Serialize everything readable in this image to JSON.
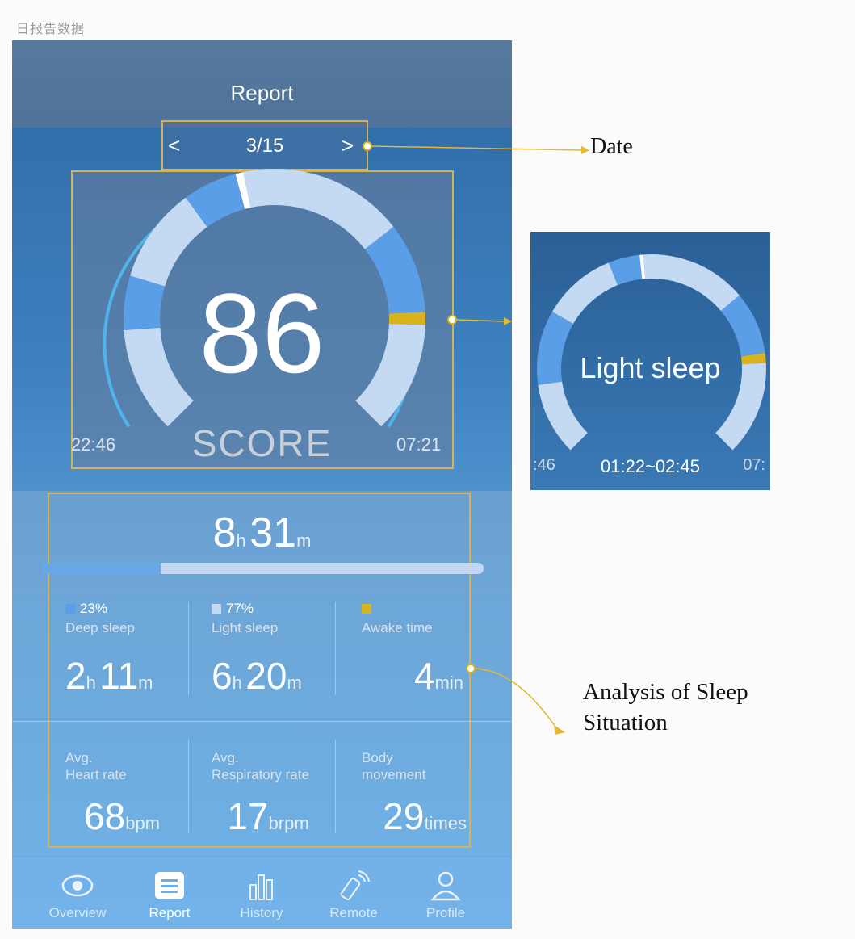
{
  "page_caption": "日报告数据",
  "header": {
    "title": "Report"
  },
  "date_nav": {
    "prev": "<",
    "date": "3/15",
    "next": ">"
  },
  "score": {
    "value": "86",
    "label": "SCORE",
    "start_time": "22:46",
    "end_time": "07:21"
  },
  "summary": {
    "total_hours": "8",
    "total_hours_unit": "h",
    "total_minutes": "31",
    "total_minutes_unit": "m",
    "deep_fraction": 0.27
  },
  "stages": [
    {
      "pct": "23%",
      "label": "Deep sleep",
      "v1": "2",
      "u1": "h",
      "v2": "11",
      "u2": "m",
      "color": "#5b9ee8"
    },
    {
      "pct": "77%",
      "label": "Light sleep",
      "v1": "6",
      "u1": "h",
      "v2": "20",
      "u2": "m",
      "color": "#c4d9f2"
    },
    {
      "pct": "",
      "label": "Awake time",
      "v1": "4",
      "u1": "min",
      "color": "#d9b21c"
    }
  ],
  "metrics": [
    {
      "label1": "Avg.",
      "label2": "Heart rate",
      "value": "68",
      "unit": "bpm"
    },
    {
      "label1": "Avg.",
      "label2": "Respiratory rate",
      "value": "17",
      "unit": "brpm"
    },
    {
      "label1": "Body",
      "label2": "movement",
      "value": "29",
      "unit": "times"
    }
  ],
  "tabs": [
    {
      "label": "Overview",
      "icon": "eye-icon"
    },
    {
      "label": "Report",
      "icon": "list-icon",
      "active": true
    },
    {
      "label": "History",
      "icon": "bar-chart-icon"
    },
    {
      "label": "Remote",
      "icon": "remote-icon"
    },
    {
      "label": "Profile",
      "icon": "user-icon"
    }
  ],
  "annotations": {
    "date": "Date",
    "analysis": "Analysis of Sleep Situation"
  },
  "inset": {
    "stage_text": "Light sleep",
    "range": "01:22~02:45",
    "left_edge": ":46",
    "right_edge": "07:"
  },
  "colors": {
    "deep": "#5b9ee8",
    "light": "#c4d9f2",
    "awake": "#d9b21c",
    "highlight": "#d2b35a"
  }
}
